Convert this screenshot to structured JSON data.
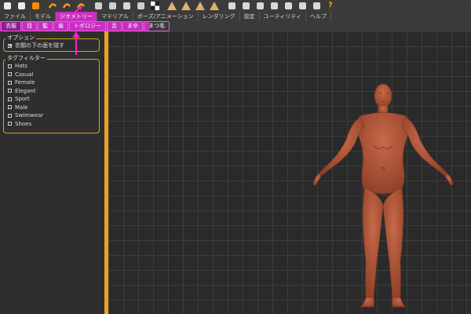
{
  "toolbar": {
    "icons": [
      "window-icon",
      "file-icon",
      "save-icon",
      "undo-icon",
      "redo-icon",
      "reset-icon",
      "pose-icon",
      "mesh-icon",
      "figure-icon",
      "grid-icon",
      "checker-icon",
      "front-view-icon",
      "side-view-icon",
      "back-view-icon",
      "top-view-icon",
      "head-icon",
      "torso-icon",
      "arm-icon",
      "leg-icon",
      "sphere-icon",
      "smooth-icon",
      "camera-icon",
      "help-icon"
    ],
    "help_glyph": "?"
  },
  "menu": {
    "items": [
      "ファイル",
      "モデル",
      "ジオメトリー",
      "マテリアル",
      "ポーズ/アニメーション",
      "レンダリング",
      "設定",
      "ユーティリティ",
      "ヘルプ"
    ],
    "active_index": 2
  },
  "submenu": {
    "tabs": [
      "衣服",
      "目",
      "髪",
      "歯",
      "トポロジー",
      "舌",
      "まゆ",
      "まつ毛"
    ],
    "selected_index": 0
  },
  "options_panel": {
    "title": "オプション",
    "items": [
      {
        "label": "衣類の下の面を隠す",
        "checked": true
      }
    ]
  },
  "tag_filter": {
    "title": "タグフィルター",
    "items": [
      "Hats",
      "Casual",
      "Female",
      "Elegant",
      "Sport",
      "Male",
      "Swimwear",
      "Shoes"
    ]
  },
  "colors": {
    "accent": "#c72fc0",
    "panel_border": "#d8a21a",
    "splitter": "#f0a020",
    "skin": "#b55a3c"
  }
}
